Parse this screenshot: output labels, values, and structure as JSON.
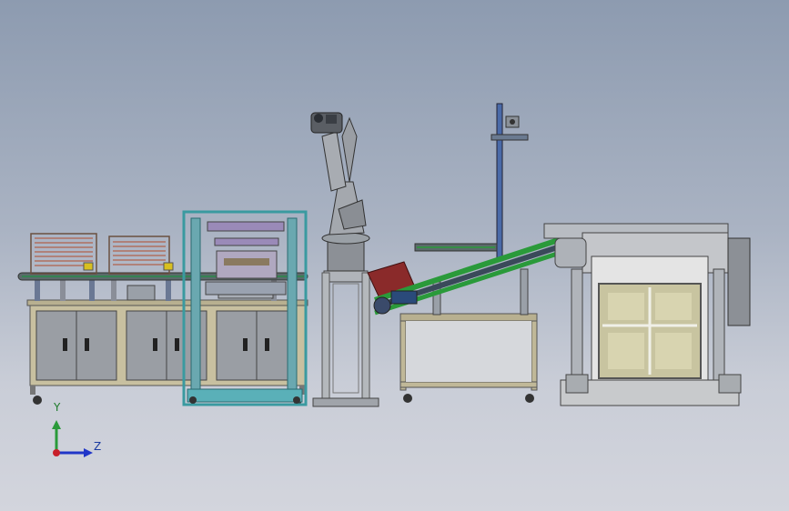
{
  "view_triad": {
    "y_label": "Y",
    "z_label": "Z",
    "colors": {
      "y_axis": "#2a9a3a",
      "z_axis": "#2036c8",
      "x_axis": "#c8202a"
    }
  },
  "scene": {
    "viewport_background": [
      "#8d9bb0",
      "#d3d5dd"
    ],
    "components": [
      "left-workbench-conveyor",
      "part-stack-racks",
      "teal-frame-press",
      "industrial-robot-arm",
      "robot-pedestal",
      "lamp-post-sensor",
      "incline-belt-conveyor",
      "conveyor-cart",
      "right-processing-machine"
    ]
  }
}
